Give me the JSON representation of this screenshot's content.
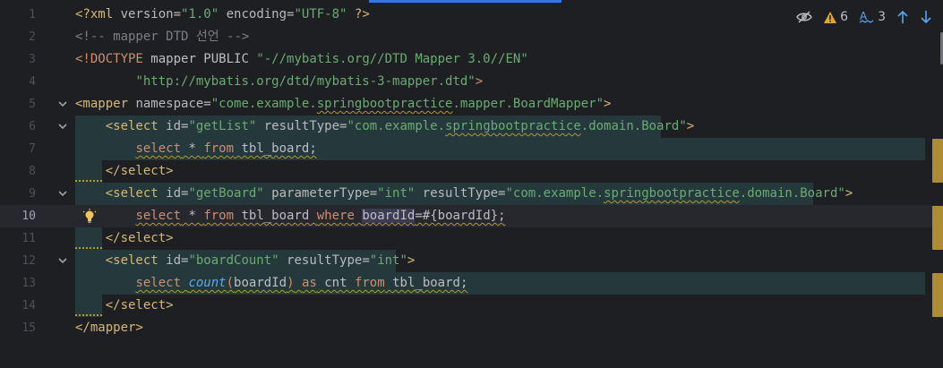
{
  "editor": {
    "inspections": {
      "warnings_count": "6",
      "typos_count": "3"
    },
    "colors": {
      "tag": "#d5b778",
      "string": "#6aab73",
      "keyword": "#cf8e6d",
      "function": "#56a8f5",
      "comment": "#7a7e85",
      "warning": "#e2a628",
      "highlight_band": "#25393c",
      "accent": "#3574f0"
    },
    "current_line": "10",
    "lines": [
      {
        "num": "1",
        "t": [
          {
            "c": "tag",
            "v": "<?xml "
          },
          {
            "c": "attr",
            "v": "version="
          },
          {
            "c": "str",
            "v": "\"1.0\""
          },
          {
            "c": "attr",
            "v": " encoding="
          },
          {
            "c": "str",
            "v": "\"UTF-8\""
          },
          {
            "c": "tag",
            "v": " ?>"
          }
        ]
      },
      {
        "num": "2",
        "t": [
          {
            "c": "cmt",
            "v": "<!-- mapper DTD 선언 -->"
          }
        ]
      },
      {
        "num": "3",
        "t": [
          {
            "c": "kw",
            "v": "<!DOCTYPE "
          },
          {
            "c": "plain",
            "v": "mapper PUBLIC "
          },
          {
            "c": "str",
            "v": "\"-//mybatis.org//DTD Mapper 3.0//EN\""
          }
        ]
      },
      {
        "num": "4",
        "t": [
          {
            "c": "plain",
            "v": "        "
          },
          {
            "c": "str",
            "v": "\"http://mybatis.org/dtd/mybatis-3-mapper.dtd\""
          },
          {
            "c": "kw",
            "v": ">"
          }
        ]
      },
      {
        "num": "5",
        "fold": true,
        "t": [
          {
            "c": "tag",
            "v": "<mapper "
          },
          {
            "c": "attr",
            "v": "namespace="
          },
          {
            "c": "str",
            "v": "\"come.example."
          },
          {
            "c": "str squig",
            "v": "springbootpractice"
          },
          {
            "c": "str",
            "v": ".mapper.BoardMapper\""
          },
          {
            "c": "tag",
            "v": ">"
          }
        ]
      },
      {
        "num": "6",
        "fold": true,
        "t": [
          {
            "c": "plain",
            "v": "    "
          },
          {
            "c": "tag",
            "v": "<select "
          },
          {
            "c": "attr",
            "v": "id="
          },
          {
            "c": "str",
            "v": "\"getList\""
          },
          {
            "c": "attr",
            "v": " resultType="
          },
          {
            "c": "str",
            "v": "\"com.example."
          },
          {
            "c": "str squig",
            "v": "springbootpractice"
          },
          {
            "c": "str",
            "v": ".domain.Board\""
          },
          {
            "c": "tag",
            "v": ">"
          }
        ]
      },
      {
        "num": "7",
        "t": [
          {
            "c": "plain",
            "v": "        "
          },
          {
            "c": "kw squig",
            "v": "select"
          },
          {
            "c": "plain squig",
            "v": " * "
          },
          {
            "c": "kw squig",
            "v": "from"
          },
          {
            "c": "plain squig",
            "v": " tbl_board;"
          }
        ]
      },
      {
        "num": "8",
        "t": [
          {
            "c": "plain",
            "v": "    "
          },
          {
            "c": "tag",
            "v": "</select>"
          }
        ]
      },
      {
        "num": "9",
        "fold": true,
        "t": [
          {
            "c": "plain",
            "v": "    "
          },
          {
            "c": "tag",
            "v": "<select "
          },
          {
            "c": "attr",
            "v": "id="
          },
          {
            "c": "str",
            "v": "\"getBoard\""
          },
          {
            "c": "attr",
            "v": " parameterType="
          },
          {
            "c": "str",
            "v": "\"int\""
          },
          {
            "c": "attr",
            "v": " resultType="
          },
          {
            "c": "str",
            "v": "\"com.example."
          },
          {
            "c": "str squig",
            "v": "springbootpractice"
          },
          {
            "c": "str",
            "v": ".domain.Board\""
          },
          {
            "c": "tag",
            "v": ">"
          }
        ]
      },
      {
        "num": "10",
        "bulb": true,
        "t": [
          {
            "c": "plain",
            "v": "        "
          },
          {
            "c": "kw squig",
            "v": "select"
          },
          {
            "c": "plain squig",
            "v": " * "
          },
          {
            "c": "kw squig",
            "v": "from"
          },
          {
            "c": "plain squig",
            "v": " tbl_board "
          },
          {
            "c": "kw squig",
            "v": "where"
          },
          {
            "c": "plain squig",
            "v": " "
          },
          {
            "c": "plain squig ident-hl",
            "v": "boardId"
          },
          {
            "c": "plain squig",
            "v": "=#{boardId};"
          }
        ]
      },
      {
        "num": "11",
        "t": [
          {
            "c": "plain",
            "v": "    "
          },
          {
            "c": "tag",
            "v": "</select>"
          }
        ]
      },
      {
        "num": "12",
        "fold": true,
        "t": [
          {
            "c": "plain",
            "v": "    "
          },
          {
            "c": "tag",
            "v": "<select "
          },
          {
            "c": "attr",
            "v": "id="
          },
          {
            "c": "str",
            "v": "\"boardCount\""
          },
          {
            "c": "attr",
            "v": " resultType="
          },
          {
            "c": "str",
            "v": "\"int\""
          },
          {
            "c": "tag",
            "v": ">"
          }
        ]
      },
      {
        "num": "13",
        "t": [
          {
            "c": "plain",
            "v": "        "
          },
          {
            "c": "kw squig",
            "v": "select"
          },
          {
            "c": "plain squig",
            "v": " "
          },
          {
            "c": "fn squig",
            "v": "count"
          },
          {
            "c": "kw squig",
            "v": "("
          },
          {
            "c": "plain squig",
            "v": "boardId"
          },
          {
            "c": "kw squig",
            "v": ")"
          },
          {
            "c": "plain squig",
            "v": " "
          },
          {
            "c": "kw squig",
            "v": "as"
          },
          {
            "c": "plain squig",
            "v": " cnt "
          },
          {
            "c": "kw squig",
            "v": "from"
          },
          {
            "c": "plain squig",
            "v": " tbl_board;"
          }
        ]
      },
      {
        "num": "14",
        "t": [
          {
            "c": "plain",
            "v": "    "
          },
          {
            "c": "tag",
            "v": "</select>"
          }
        ]
      },
      {
        "num": "15",
        "t": [
          {
            "c": "tag",
            "v": "</mapper>"
          }
        ]
      }
    ]
  }
}
